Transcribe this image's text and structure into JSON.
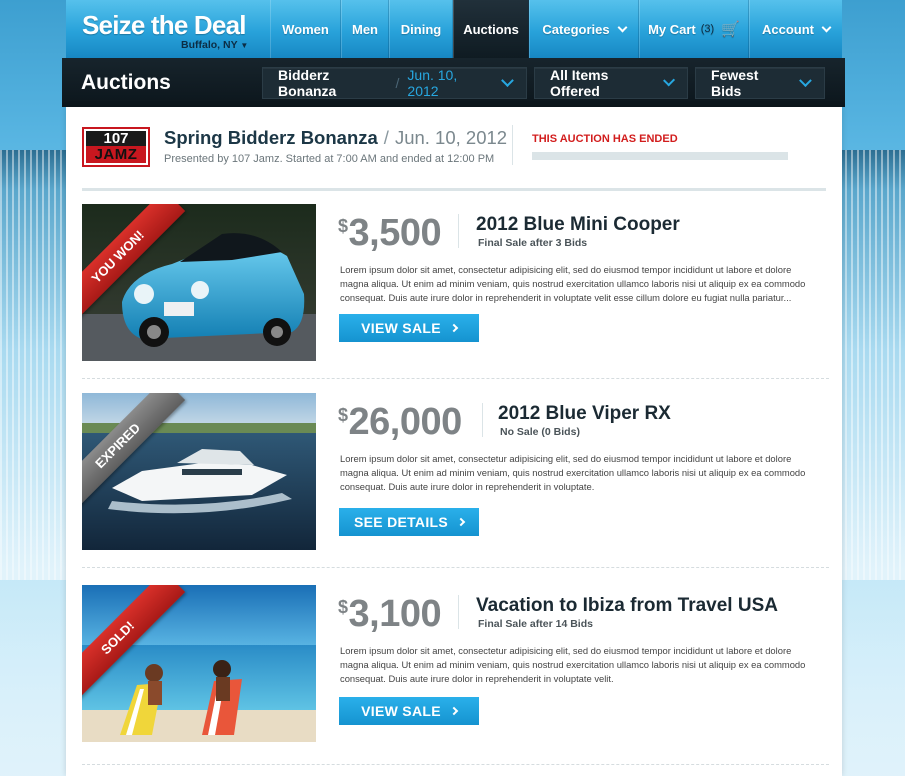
{
  "brand": {
    "title": "Seize the Deal",
    "city": "Buffalo, NY"
  },
  "nav": {
    "items": [
      "Women",
      "Men",
      "Dining",
      "Auctions",
      "Categories",
      "My Cart",
      "Account"
    ],
    "active": "Auctions",
    "cart_count": "(3)"
  },
  "subbar": {
    "title": "Auctions",
    "event_name": "Bidderz Bonanza",
    "event_date": "Jun. 10, 2012",
    "filter": "All Items Offered",
    "sort": "Fewest Bids"
  },
  "auction": {
    "sponsor_logo": {
      "top": "107",
      "bottom": "JAMZ"
    },
    "title": "Spring Bidderz Bonanza",
    "date": "Jun. 10, 2012",
    "subtitle": "Presented by 107 Jamz. Started at 7:00 AM and ended at 12:00 PM",
    "status": "THIS AUCTION HAS ENDED"
  },
  "items": [
    {
      "ribbon": "YOU WON!",
      "price": "3,500",
      "title": "2012 Blue Mini Cooper",
      "subtitle": "Final Sale after 3 Bids",
      "description": "Lorem ipsum dolor sit amet, consectetur adipisicing elit, sed do eiusmod tempor incididunt ut labore et dolore magna aliqua. Ut enim ad minim veniam, quis nostrud exercitation ullamco laboris nisi ut aliquip ex ea commodo consequat. Duis aute irure dolor in reprehenderit in voluptate velit esse cillum dolore eu fugiat nulla pariatur...",
      "button": "VIEW SALE"
    },
    {
      "ribbon": "EXPIRED",
      "price": "26,000",
      "title": "2012 Blue Viper RX",
      "subtitle": "No Sale (0 Bids)",
      "description": "Lorem ipsum dolor sit amet, consectetur adipisicing elit, sed do eiusmod tempor incididunt ut labore et dolore magna aliqua. Ut enim ad minim veniam, quis nostrud exercitation ullamco laboris nisi ut aliquip ex ea commodo consequat. Duis aute irure dolor in reprehenderit in voluptate.",
      "button": "SEE DETAILS"
    },
    {
      "ribbon": "SOLD!",
      "price": "3,100",
      "title": "Vacation to Ibiza from Travel USA",
      "subtitle": "Final Sale after 14 Bids",
      "description": "Lorem ipsum dolor sit amet, consectetur adipisicing elit, sed do eiusmod tempor incididunt ut labore et dolore magna aliqua. Ut enim ad minim veniam, quis nostrud exercitation ullamco laboris nisi ut aliquip ex ea commodo consequat. Duis aute irure dolor in reprehenderit in voluptate velit.",
      "button": "VIEW SALE"
    }
  ],
  "icons": [
    "chevron-down-icon",
    "cart-icon",
    "chevron-right-icon"
  ],
  "colors": {
    "accent": "#27a7e0",
    "status_red": "#d21d1d",
    "ribbon_red": "#c8241f",
    "ribbon_grey": "#6f6f6f"
  }
}
